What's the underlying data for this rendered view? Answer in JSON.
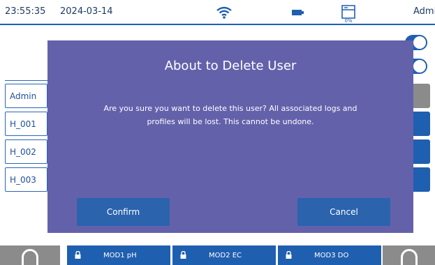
{
  "status_bar": {
    "time": "23:55:35",
    "date": "2024-03-14",
    "storage_percent": "0%",
    "user": "Admi"
  },
  "users": [
    {
      "label": "Admin"
    },
    {
      "label": "H_001"
    },
    {
      "label": "H_002"
    },
    {
      "label": "H_003"
    }
  ],
  "dialog": {
    "title": "About to Delete User",
    "message": "Are you sure you want to delete this user? All associated logs and profiles will be lost. This cannot be undone.",
    "confirm_label": "Confirm",
    "cancel_label": "Cancel"
  },
  "modules": [
    {
      "label": "MOD1 pH"
    },
    {
      "label": "MOD2 EC"
    },
    {
      "label": "MOD3 DO"
    }
  ],
  "colors": {
    "accent": "#1f5fb0",
    "dialog": "#6461ab",
    "button": "#2b63ad",
    "nav_gray": "#8b8b8b"
  },
  "icons": {
    "status": [
      "wifi-icon",
      "battery-icon",
      "storage-icon"
    ],
    "nav": [
      "home-icon",
      "home-icon"
    ],
    "module": "lock-icon"
  }
}
